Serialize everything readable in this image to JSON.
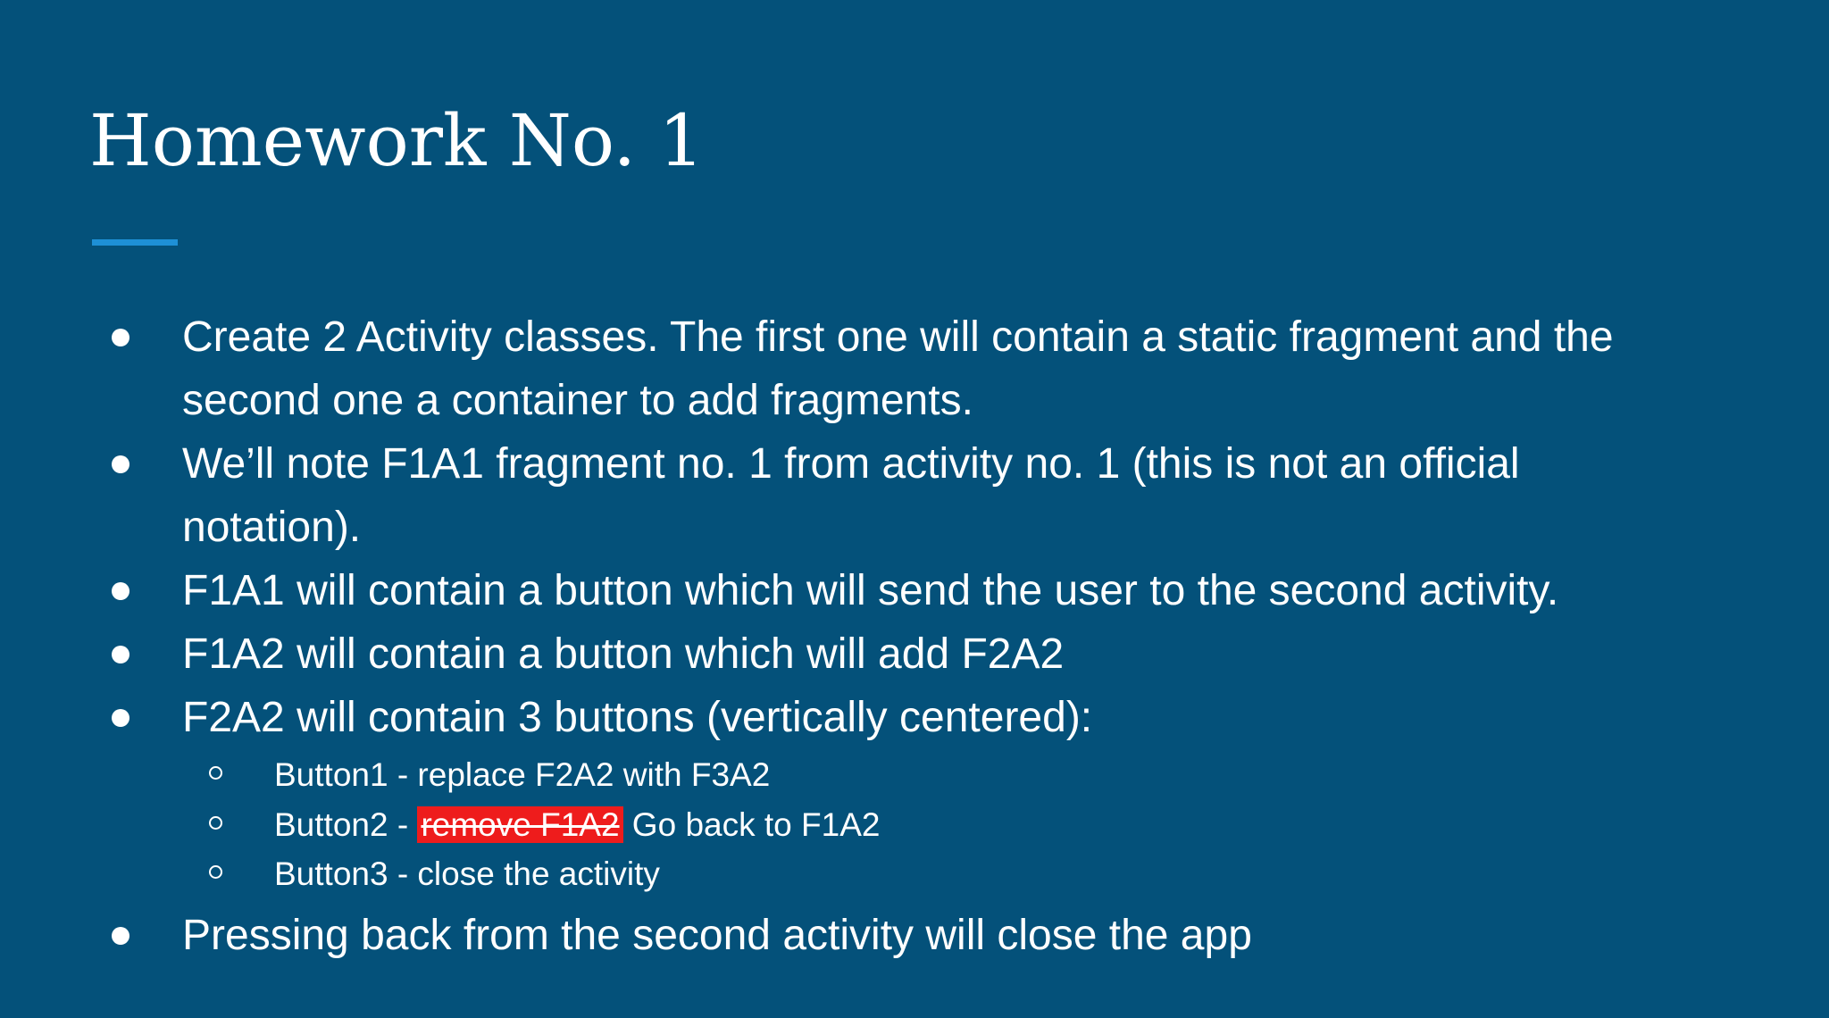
{
  "title": "Homework No. 1",
  "accent_color": "#1e90d6",
  "bullets": [
    {
      "lines": [
        "Create 2 Activity classes. The first one will contain a static fragment and the",
        "second one a container to add fragments."
      ]
    },
    {
      "lines": [
        "We’ll note F1A1 fragment no. 1 from activity no. 1 (this is not an official",
        "notation)."
      ]
    },
    {
      "lines": [
        "F1A1 will contain a button which will send the user to the second activity."
      ]
    },
    {
      "lines": [
        "F1A2 will contain a button which will add F2A2"
      ]
    },
    {
      "lines": [
        "F2A2 will contain 3 buttons (vertically centered):"
      ],
      "subitems": [
        {
          "text": "Button1 - replace F2A2 with F3A2"
        },
        {
          "prefix": "Button2 - ",
          "struck": "remove F1A2",
          "suffix": " Go back to F1A2",
          "highlight_color": "#ee1c1c"
        },
        {
          "text": "Button3 - close the activity"
        }
      ]
    },
    {
      "lines": [
        "Pressing back from the second activity will close the app"
      ]
    }
  ]
}
